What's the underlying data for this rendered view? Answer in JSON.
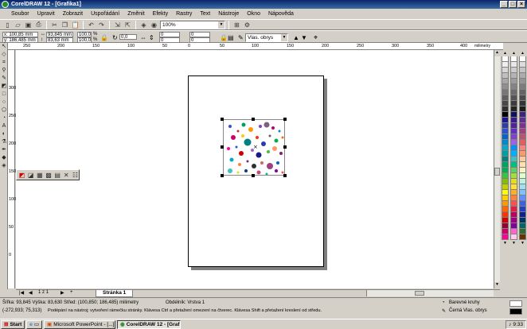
{
  "window": {
    "title": "CorelDRAW 12 - [Grafika1]"
  },
  "menu": [
    "Soubor",
    "Upravit",
    "Zobrazit",
    "Uspořádání",
    "Změnit",
    "Efekty",
    "Rastry",
    "Text",
    "Nástroje",
    "Okno",
    "Nápověda"
  ],
  "toolbar": {
    "zoom": "100%"
  },
  "propbar": {
    "x": "x: 100,85 mm",
    "y": "y: 186,485 mm",
    "w": "93,845 mm",
    "h": "83,63 mm",
    "scale_w": "100,0",
    "scale_h": "100,0",
    "pct": "%",
    "rotation": "0,0",
    "nudge1": "0",
    "nudge2": "0",
    "nudge3": "0",
    "nudge4": "0",
    "outline": "Vlas. obrys"
  },
  "rulers": {
    "units": "milimetry",
    "h_labels": [
      "250",
      "200",
      "150",
      "100",
      "50",
      "0",
      "50",
      "100",
      "150",
      "200",
      "250",
      "300",
      "350",
      "400"
    ],
    "v_labels": [
      "300",
      "250",
      "200",
      "150",
      "100",
      "50",
      "0"
    ]
  },
  "pages": {
    "counter": "1 z 1",
    "tab": "Stránka 1"
  },
  "status": {
    "size": "Šířka: 93,845 Výška: 83,630 Střed: (100,850; 186,485) milimetry",
    "object": "Obdélník: Vrstva 1",
    "coords": "(-272,933; 75,313)",
    "hint": "Podépání na nástroj; vytvoření rámečku stránky. Klávesa Ctrl a přetažení omezení na čtverec. Klávesa Shift a přetažení kreslení od středu.",
    "fill": "Barevné kruhy",
    "outline": "Černá  Vlas. obrys"
  },
  "taskbar": {
    "start": "Start",
    "items": [
      "Microsoft PowerPoint - [...]",
      "CorelDRAW 12 - [Graf..."
    ],
    "clock": "9:33"
  },
  "palette_colors": [
    [
      "#ffffff",
      "#f0f0f0",
      "#d8d8d8",
      "#c0c0c0",
      "#a8a8a8",
      "#909090",
      "#787878",
      "#606060",
      "#484848",
      "#303030",
      "#000000",
      "#1a1a8c",
      "#2a3cb0",
      "#3050d0",
      "#0066cc",
      "#0088cc",
      "#00aacc",
      "#00a0a0",
      "#008080",
      "#00a060",
      "#00b050",
      "#40c040",
      "#80c000",
      "#c0d000",
      "#ffff00",
      "#ffcc00",
      "#ff9900",
      "#ff6600",
      "#ff3300",
      "#cc0000",
      "#990033",
      "#cc0066",
      "#ff0099"
    ],
    [
      "#ffffff",
      "#e8e8e8",
      "#cccccc",
      "#b4b4b4",
      "#9c9c9c",
      "#848484",
      "#6c6c6c",
      "#545454",
      "#3c3c3c",
      "#242424",
      "#101060",
      "#3a1a8c",
      "#5020a0",
      "#6030c0",
      "#8040d0",
      "#a060e0",
      "#0090ff",
      "#00b0ff",
      "#40c0c0",
      "#00c080",
      "#60d060",
      "#a0e040",
      "#e0e020",
      "#ffe040",
      "#ffb020",
      "#ff8040",
      "#ff5050",
      "#e02040",
      "#c00060",
      "#a00080",
      "#8000a0",
      "#ff66cc",
      "#ffccee"
    ],
    [
      "#ffffff",
      "#dcdcdc",
      "#c4c4c4",
      "#acacac",
      "#949494",
      "#7c7c7c",
      "#646464",
      "#4c4c4c",
      "#343434",
      "#1c1c1c",
      "#402080",
      "#603090",
      "#803090",
      "#a04080",
      "#c05070",
      "#e06060",
      "#ff8080",
      "#ff9966",
      "#ffcc99",
      "#ffe0b0",
      "#fff0c0",
      "#e0ffd0",
      "#c0f0e0",
      "#a0e0f0",
      "#80c0ff",
      "#6090ff",
      "#4060e0",
      "#2040c0",
      "#102090",
      "#003366",
      "#006666",
      "#336633",
      "#663300"
    ]
  ]
}
